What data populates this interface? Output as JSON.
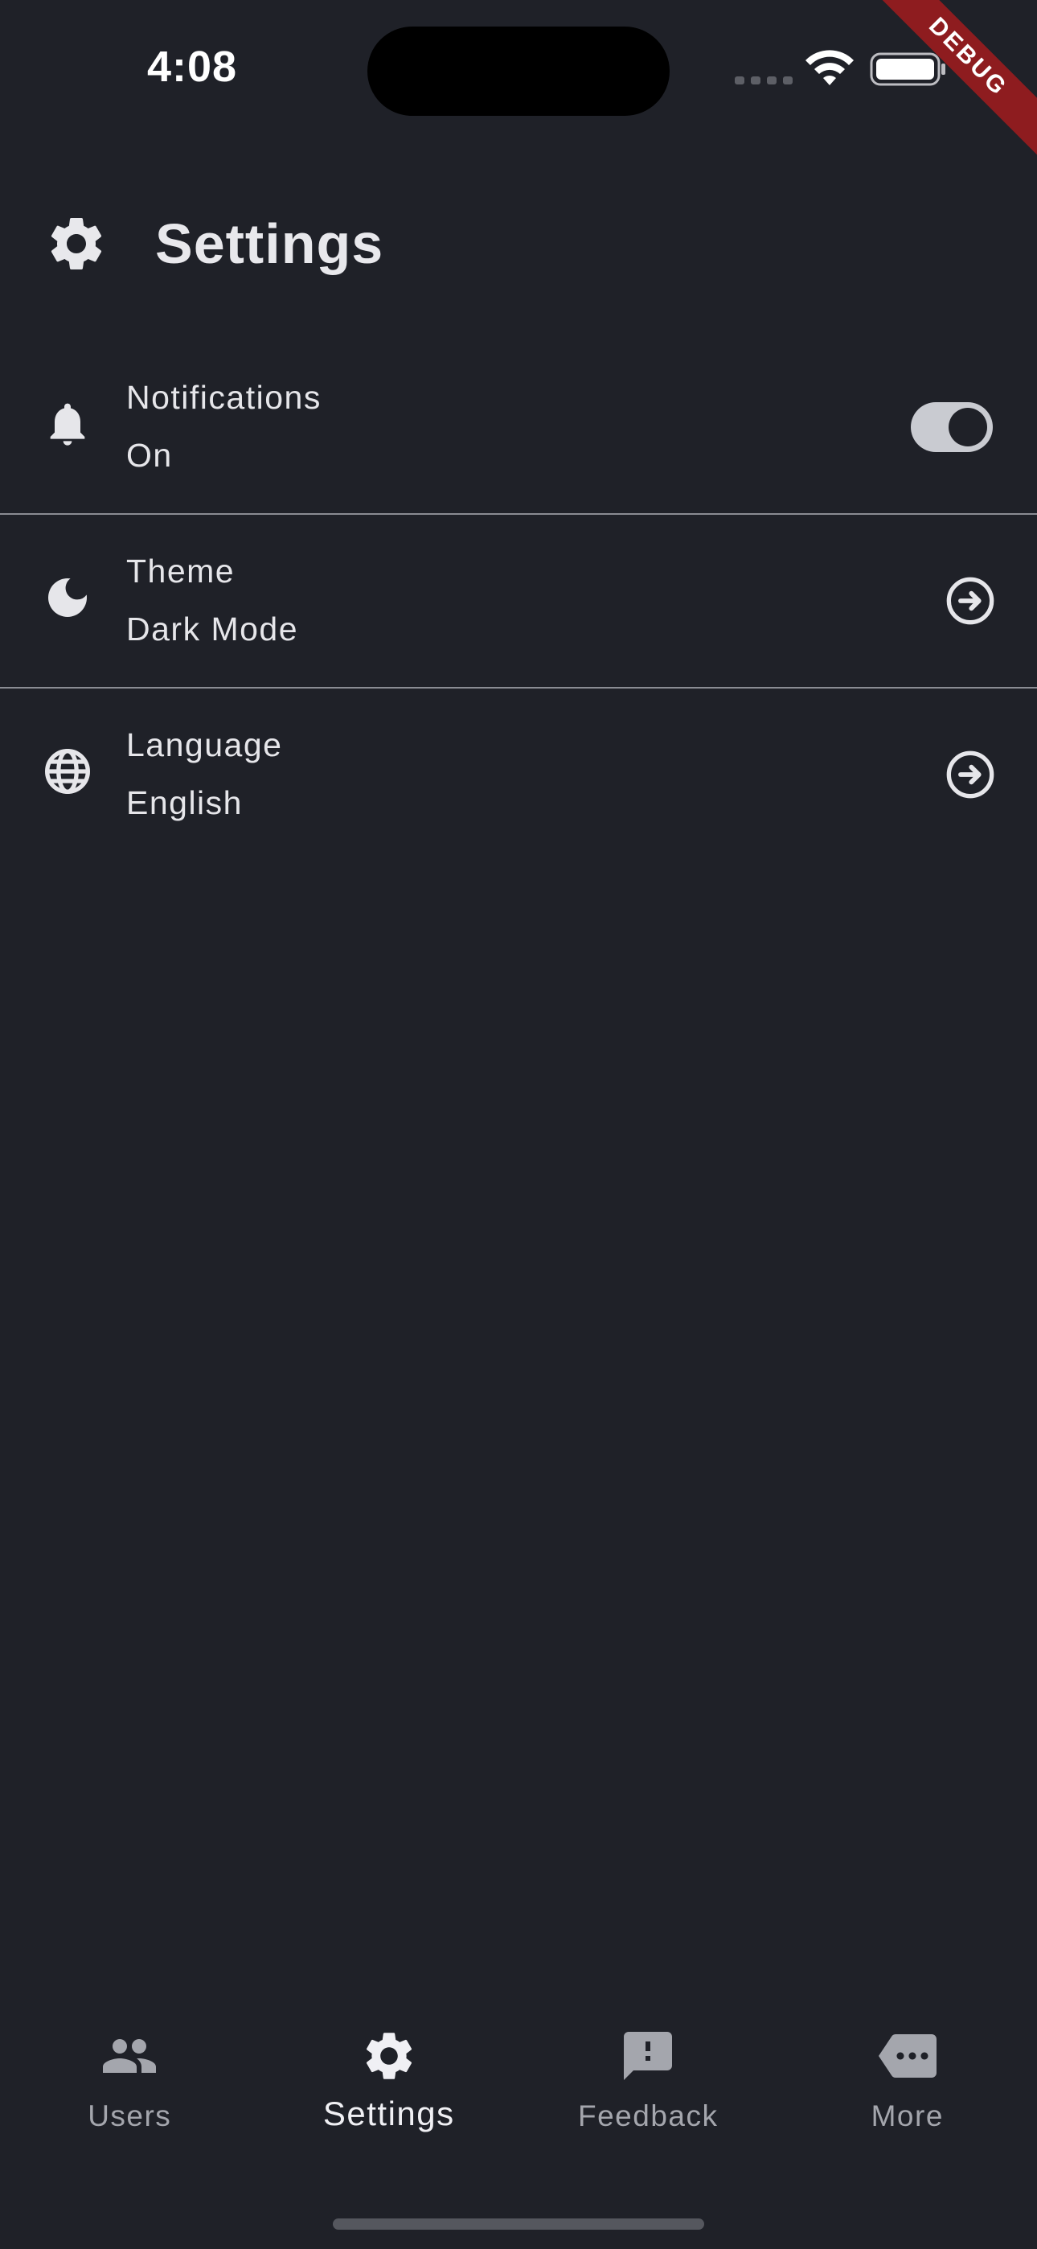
{
  "status_bar": {
    "time": "4:08",
    "debug_label": "DEBUG"
  },
  "header": {
    "icon": "gear-icon",
    "title": "Settings"
  },
  "settings": {
    "items": [
      {
        "icon": "bell-icon",
        "title": "Notifications",
        "subtitle": "On",
        "control": "toggle",
        "toggle_on": true
      },
      {
        "icon": "moon-icon",
        "title": "Theme",
        "subtitle": "Dark Mode",
        "control": "arrow-circle-right-icon"
      },
      {
        "icon": "globe-icon",
        "title": "Language",
        "subtitle": "English",
        "control": "arrow-circle-right-icon"
      }
    ]
  },
  "bottom_nav": {
    "active": "Settings",
    "items": [
      {
        "icon": "people-icon",
        "label": "Users"
      },
      {
        "icon": "gear-icon",
        "label": "Settings"
      },
      {
        "icon": "feedback-icon",
        "label": "Feedback"
      },
      {
        "icon": "more-icon",
        "label": "More"
      }
    ]
  },
  "colors": {
    "background": "#1f2128",
    "text_primary": "#e6e6ea",
    "text_inactive": "#a4a6ad",
    "divider": "#8a8c93",
    "debug_banner": "#8e1c1f"
  }
}
